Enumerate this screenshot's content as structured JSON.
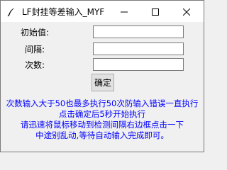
{
  "window": {
    "title": "LF封挂等差输入_MYF"
  },
  "icons": {
    "app": "feather-icon",
    "minimize": "minimize-icon",
    "maximize": "maximize-icon",
    "close": "close-icon"
  },
  "form": {
    "initial_label": "初始值:",
    "initial_value": "",
    "interval_label": "间隔:",
    "interval_value": "",
    "count_label": "次数:",
    "count_value": "",
    "confirm_label": "确定"
  },
  "instructions": {
    "line1": "次数输入大于50也最多执行50次防输入错误一直执行",
    "line2": "点击确定后5秒开始执行",
    "line3": "请迅速将鼠标移动到检测间隔右边框点击一下",
    "line4": "中途别乱动,等待自动输入完成即可。"
  },
  "colors": {
    "instruction_text": "#0000ff",
    "window_bg": "#f0f0f0",
    "titlebar_bg": "#ffffff"
  }
}
